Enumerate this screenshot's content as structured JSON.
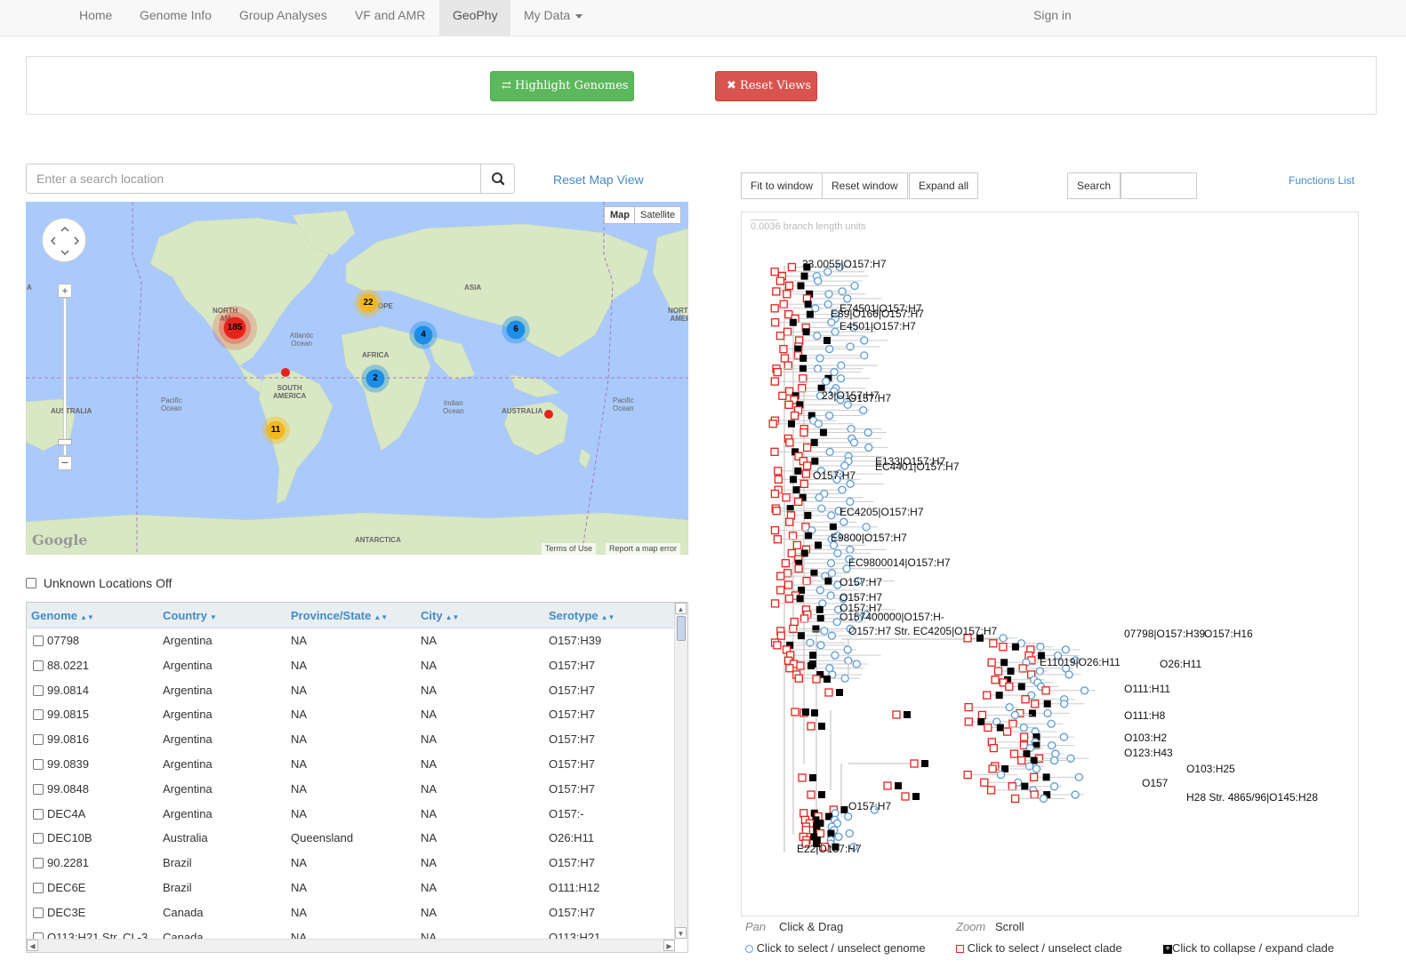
{
  "nav": {
    "items": [
      {
        "label": "Home",
        "active": false
      },
      {
        "label": "Genome Info",
        "active": false
      },
      {
        "label": "Group Analyses",
        "active": false
      },
      {
        "label": "VF and AMR",
        "active": false
      },
      {
        "label": "GeoPhy",
        "active": true
      },
      {
        "label": "My Data",
        "active": false,
        "dropdown": true
      }
    ],
    "sign_in": "Sign in"
  },
  "actions": {
    "highlight_label": "Highlight Genomes",
    "highlight_icon": "exchange-icon",
    "reset_label": "Reset Views",
    "reset_icon": "close-icon"
  },
  "map_panel": {
    "search_placeholder": "Enter a search location",
    "reset_map_label": "Reset Map View",
    "type_map": "Map",
    "type_satellite": "Satellite",
    "clusters": [
      {
        "label": "185",
        "color": "#e8221a"
      },
      {
        "label": "22",
        "color": "#f2b81d"
      },
      {
        "label": "4",
        "color": "#1d8ee6"
      },
      {
        "label": "6",
        "color": "#1d8ee6"
      },
      {
        "label": "2",
        "color": "#1d8ee6"
      },
      {
        "label": "11",
        "color": "#f2b81d"
      }
    ],
    "labels": {
      "north_america_1": "NORTH",
      "north_america_2": "AM",
      "asia": "ASIA",
      "europe": "OPE",
      "africa": "AFRICA",
      "atlantic_1": "Atlantic",
      "atlantic_2": "Ocean",
      "south_america_1": "SOUTH",
      "south_america_2": "AMERICA",
      "indian_1": "Indian",
      "indian_2": "Ocean",
      "australia": "AUSTRALIA",
      "australia_left": "AUSTRALIA",
      "pacific_l1": "Pacific",
      "pacific_l2": "Ocean",
      "pacific_r1": "Pacific",
      "pacific_r2": "Ocean",
      "antarctica": "ANTARCTICA",
      "north_amer_right_1": "NORTH",
      "north_amer_right_2": "AMER",
      "left_edge": "A"
    },
    "google": "Google",
    "terms": "Terms of Use",
    "report": "Report a map error"
  },
  "unknown_locations_label": "Unknown Locations Off",
  "table": {
    "columns": [
      "Genome",
      "Country",
      "Province/State",
      "City",
      "Serotype"
    ],
    "sorted_column": "Country",
    "rows": [
      [
        "07798",
        "Argentina",
        "NA",
        "NA",
        "O157:H39"
      ],
      [
        "88.0221",
        "Argentina",
        "NA",
        "NA",
        "O157:H7"
      ],
      [
        "99.0814",
        "Argentina",
        "NA",
        "NA",
        "O157:H7"
      ],
      [
        "99.0815",
        "Argentina",
        "NA",
        "NA",
        "O157:H7"
      ],
      [
        "99.0816",
        "Argentina",
        "NA",
        "NA",
        "O157:H7"
      ],
      [
        "99.0839",
        "Argentina",
        "NA",
        "NA",
        "O157:H7"
      ],
      [
        "99.0848",
        "Argentina",
        "NA",
        "NA",
        "O157:H7"
      ],
      [
        "DEC4A",
        "Argentina",
        "NA",
        "NA",
        "O157:-"
      ],
      [
        "DEC10B",
        "Australia",
        "Queensland",
        "NA",
        "O26:H11"
      ],
      [
        "90.2281",
        "Brazil",
        "NA",
        "NA",
        "O157:H7"
      ],
      [
        "DEC6E",
        "Brazil",
        "NA",
        "NA",
        "O111:H12"
      ],
      [
        "DEC3E",
        "Canada",
        "NA",
        "NA",
        "O157:H7"
      ],
      [
        "O113:H21 Str. CL-3",
        "Canada",
        "NA",
        "NA",
        "O113:H21"
      ]
    ]
  },
  "tree_panel": {
    "fit_label": "Fit to window",
    "reset_label": "Reset window",
    "expand_label": "Expand all",
    "search_label": "Search",
    "functions_label": "Functions List",
    "scale_label": "0.0036 branch length units",
    "leaf_labels": [
      "33.0055|O157:H7",
      "E74501|O157:H7",
      "E89|O166|O157:H7",
      "E4501|O157:H7",
      "23|O157:H7",
      "O157:H7",
      "E133|O157:H7-",
      "EC4401|O157:H7",
      "O157:H7",
      "EC4205|O157:H7",
      "E9800|O157:H7",
      "EC9800014|O157:H7",
      "O157:H7",
      "O157:H7",
      "O157:H7",
      "O157400000|O157:H-",
      "O157:H7 Str. EC4205|O157:H7",
      "07798|O157:H39",
      "O157:H16",
      "E11019|O26:H11",
      "O26:H11",
      "O111:H11",
      "O111:H8",
      "O103:H2",
      "O123:H43",
      "O103:H25",
      "O157",
      "H28 Str. 4865/96|O145:H28",
      "O157:H7",
      "E22|O157:H7"
    ],
    "pan_key": "Pan",
    "pan_value": "Click & Drag",
    "zoom_key": "Zoom",
    "zoom_value": "Scroll",
    "legend_genome": "Click to select / unselect genome",
    "legend_clade": "Click to select / unselect clade",
    "legend_collapse": "Click to collapse / expand clade",
    "colors": {
      "genome": "#5b9bd5",
      "clade": "#e8221a",
      "collapse": "#000000"
    }
  }
}
